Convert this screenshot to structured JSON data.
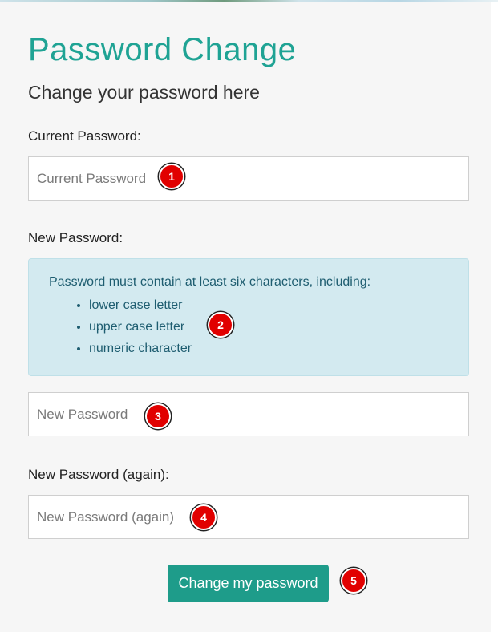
{
  "page": {
    "title": "Password Change",
    "subtitle": "Change your password here"
  },
  "form": {
    "current_password": {
      "label": "Current Password:",
      "placeholder": "Current Password",
      "value": ""
    },
    "new_password": {
      "label": "New Password:",
      "placeholder": "New Password",
      "value": ""
    },
    "new_password_again": {
      "label": "New Password (again):",
      "placeholder": "New Password (again)",
      "value": ""
    },
    "requirements": {
      "intro": "Password must contain at least six characters, including:",
      "items": [
        "lower case letter",
        "upper case letter",
        "numeric character"
      ]
    },
    "submit_label": "Change my password"
  },
  "markers": [
    "1",
    "2",
    "3",
    "4",
    "5"
  ],
  "colors": {
    "accent": "#1fa394",
    "button": "#1e9c8a",
    "info_bg": "#d3eaf0",
    "info_text": "#1e5d70",
    "marker": "#e10000"
  }
}
